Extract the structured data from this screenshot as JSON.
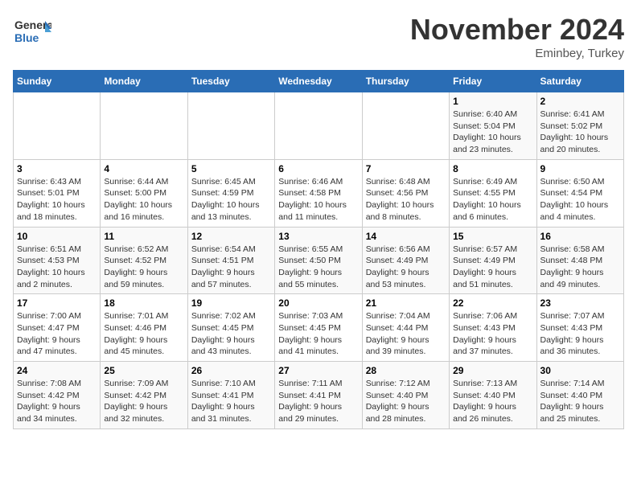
{
  "header": {
    "logo_line1": "General",
    "logo_line2": "Blue",
    "month_title": "November 2024",
    "location": "Eminbey, Turkey"
  },
  "weekdays": [
    "Sunday",
    "Monday",
    "Tuesday",
    "Wednesday",
    "Thursday",
    "Friday",
    "Saturday"
  ],
  "weeks": [
    [
      {
        "day": "",
        "info": ""
      },
      {
        "day": "",
        "info": ""
      },
      {
        "day": "",
        "info": ""
      },
      {
        "day": "",
        "info": ""
      },
      {
        "day": "",
        "info": ""
      },
      {
        "day": "1",
        "info": "Sunrise: 6:40 AM\nSunset: 5:04 PM\nDaylight: 10 hours\nand 23 minutes."
      },
      {
        "day": "2",
        "info": "Sunrise: 6:41 AM\nSunset: 5:02 PM\nDaylight: 10 hours\nand 20 minutes."
      }
    ],
    [
      {
        "day": "3",
        "info": "Sunrise: 6:43 AM\nSunset: 5:01 PM\nDaylight: 10 hours\nand 18 minutes."
      },
      {
        "day": "4",
        "info": "Sunrise: 6:44 AM\nSunset: 5:00 PM\nDaylight: 10 hours\nand 16 minutes."
      },
      {
        "day": "5",
        "info": "Sunrise: 6:45 AM\nSunset: 4:59 PM\nDaylight: 10 hours\nand 13 minutes."
      },
      {
        "day": "6",
        "info": "Sunrise: 6:46 AM\nSunset: 4:58 PM\nDaylight: 10 hours\nand 11 minutes."
      },
      {
        "day": "7",
        "info": "Sunrise: 6:48 AM\nSunset: 4:56 PM\nDaylight: 10 hours\nand 8 minutes."
      },
      {
        "day": "8",
        "info": "Sunrise: 6:49 AM\nSunset: 4:55 PM\nDaylight: 10 hours\nand 6 minutes."
      },
      {
        "day": "9",
        "info": "Sunrise: 6:50 AM\nSunset: 4:54 PM\nDaylight: 10 hours\nand 4 minutes."
      }
    ],
    [
      {
        "day": "10",
        "info": "Sunrise: 6:51 AM\nSunset: 4:53 PM\nDaylight: 10 hours\nand 2 minutes."
      },
      {
        "day": "11",
        "info": "Sunrise: 6:52 AM\nSunset: 4:52 PM\nDaylight: 9 hours\nand 59 minutes."
      },
      {
        "day": "12",
        "info": "Sunrise: 6:54 AM\nSunset: 4:51 PM\nDaylight: 9 hours\nand 57 minutes."
      },
      {
        "day": "13",
        "info": "Sunrise: 6:55 AM\nSunset: 4:50 PM\nDaylight: 9 hours\nand 55 minutes."
      },
      {
        "day": "14",
        "info": "Sunrise: 6:56 AM\nSunset: 4:49 PM\nDaylight: 9 hours\nand 53 minutes."
      },
      {
        "day": "15",
        "info": "Sunrise: 6:57 AM\nSunset: 4:49 PM\nDaylight: 9 hours\nand 51 minutes."
      },
      {
        "day": "16",
        "info": "Sunrise: 6:58 AM\nSunset: 4:48 PM\nDaylight: 9 hours\nand 49 minutes."
      }
    ],
    [
      {
        "day": "17",
        "info": "Sunrise: 7:00 AM\nSunset: 4:47 PM\nDaylight: 9 hours\nand 47 minutes."
      },
      {
        "day": "18",
        "info": "Sunrise: 7:01 AM\nSunset: 4:46 PM\nDaylight: 9 hours\nand 45 minutes."
      },
      {
        "day": "19",
        "info": "Sunrise: 7:02 AM\nSunset: 4:45 PM\nDaylight: 9 hours\nand 43 minutes."
      },
      {
        "day": "20",
        "info": "Sunrise: 7:03 AM\nSunset: 4:45 PM\nDaylight: 9 hours\nand 41 minutes."
      },
      {
        "day": "21",
        "info": "Sunrise: 7:04 AM\nSunset: 4:44 PM\nDaylight: 9 hours\nand 39 minutes."
      },
      {
        "day": "22",
        "info": "Sunrise: 7:06 AM\nSunset: 4:43 PM\nDaylight: 9 hours\nand 37 minutes."
      },
      {
        "day": "23",
        "info": "Sunrise: 7:07 AM\nSunset: 4:43 PM\nDaylight: 9 hours\nand 36 minutes."
      }
    ],
    [
      {
        "day": "24",
        "info": "Sunrise: 7:08 AM\nSunset: 4:42 PM\nDaylight: 9 hours\nand 34 minutes."
      },
      {
        "day": "25",
        "info": "Sunrise: 7:09 AM\nSunset: 4:42 PM\nDaylight: 9 hours\nand 32 minutes."
      },
      {
        "day": "26",
        "info": "Sunrise: 7:10 AM\nSunset: 4:41 PM\nDaylight: 9 hours\nand 31 minutes."
      },
      {
        "day": "27",
        "info": "Sunrise: 7:11 AM\nSunset: 4:41 PM\nDaylight: 9 hours\nand 29 minutes."
      },
      {
        "day": "28",
        "info": "Sunrise: 7:12 AM\nSunset: 4:40 PM\nDaylight: 9 hours\nand 28 minutes."
      },
      {
        "day": "29",
        "info": "Sunrise: 7:13 AM\nSunset: 4:40 PM\nDaylight: 9 hours\nand 26 minutes."
      },
      {
        "day": "30",
        "info": "Sunrise: 7:14 AM\nSunset: 4:40 PM\nDaylight: 9 hours\nand 25 minutes."
      }
    ]
  ]
}
